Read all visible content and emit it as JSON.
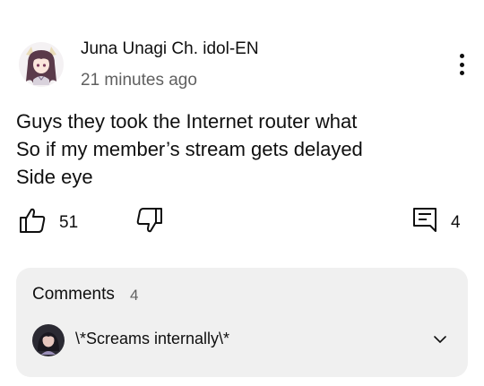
{
  "post": {
    "author": "Juna Unagi Ch. idol-EN",
    "time": "21 minutes ago",
    "lines": [
      "Guys they took the Internet router what",
      "So if my member’s stream gets delayed",
      "Side eye"
    ],
    "likes": "51",
    "comment_count": "4"
  },
  "icons": {
    "menu": "more-vert-icon",
    "like": "thumbs-up-icon",
    "dislike": "thumbs-down-icon",
    "comment": "comment-icon",
    "expand": "chevron-down-icon"
  },
  "comments_section": {
    "title": "Comments",
    "count": "4",
    "preview_text": "\\*Screams internally\\*"
  },
  "colors": {
    "text_primary": "#0f0f0f",
    "text_secondary": "#606060",
    "card_background": "#f0f0f0"
  }
}
